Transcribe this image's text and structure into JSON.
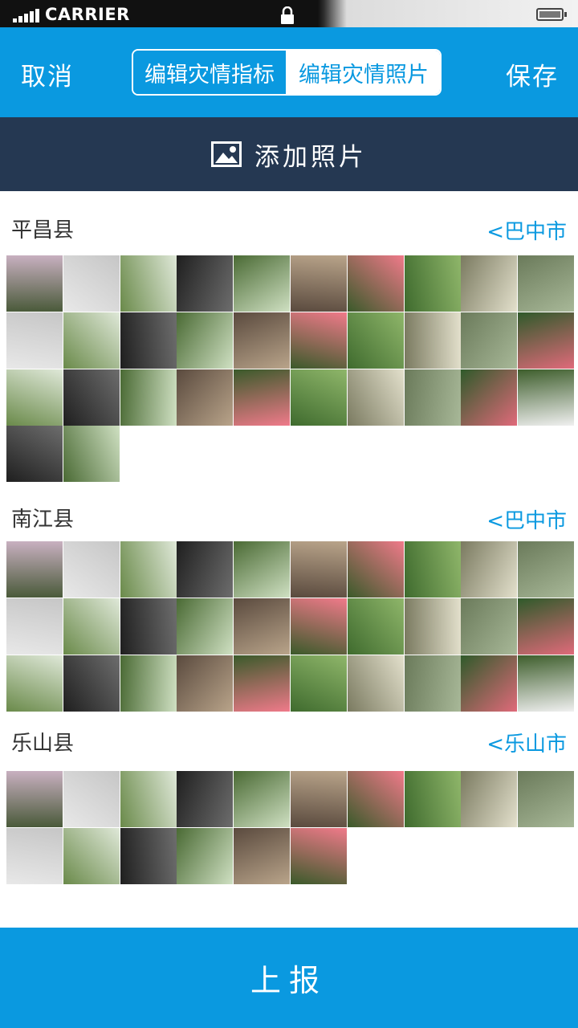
{
  "status_bar": {
    "carrier": "CARRIER"
  },
  "nav": {
    "cancel": "取消",
    "save": "保存",
    "tabs": [
      {
        "label": "编辑灾情指标",
        "active": true
      },
      {
        "label": "编辑灾情照片",
        "active": false
      }
    ]
  },
  "add_photo": {
    "label": "添加照片",
    "icon": "image-icon"
  },
  "sections": [
    {
      "county": "平昌县",
      "city": "<巴中市",
      "photo_count": 32
    },
    {
      "county": "南江县",
      "city": "<巴中市",
      "photo_count": 30
    },
    {
      "county": "乐山县",
      "city": "<乐山市",
      "photo_count": 16
    }
  ],
  "bottom": {
    "report": "上报"
  },
  "colors": {
    "accent": "#0a99e0",
    "dark_bar": "#253852"
  }
}
